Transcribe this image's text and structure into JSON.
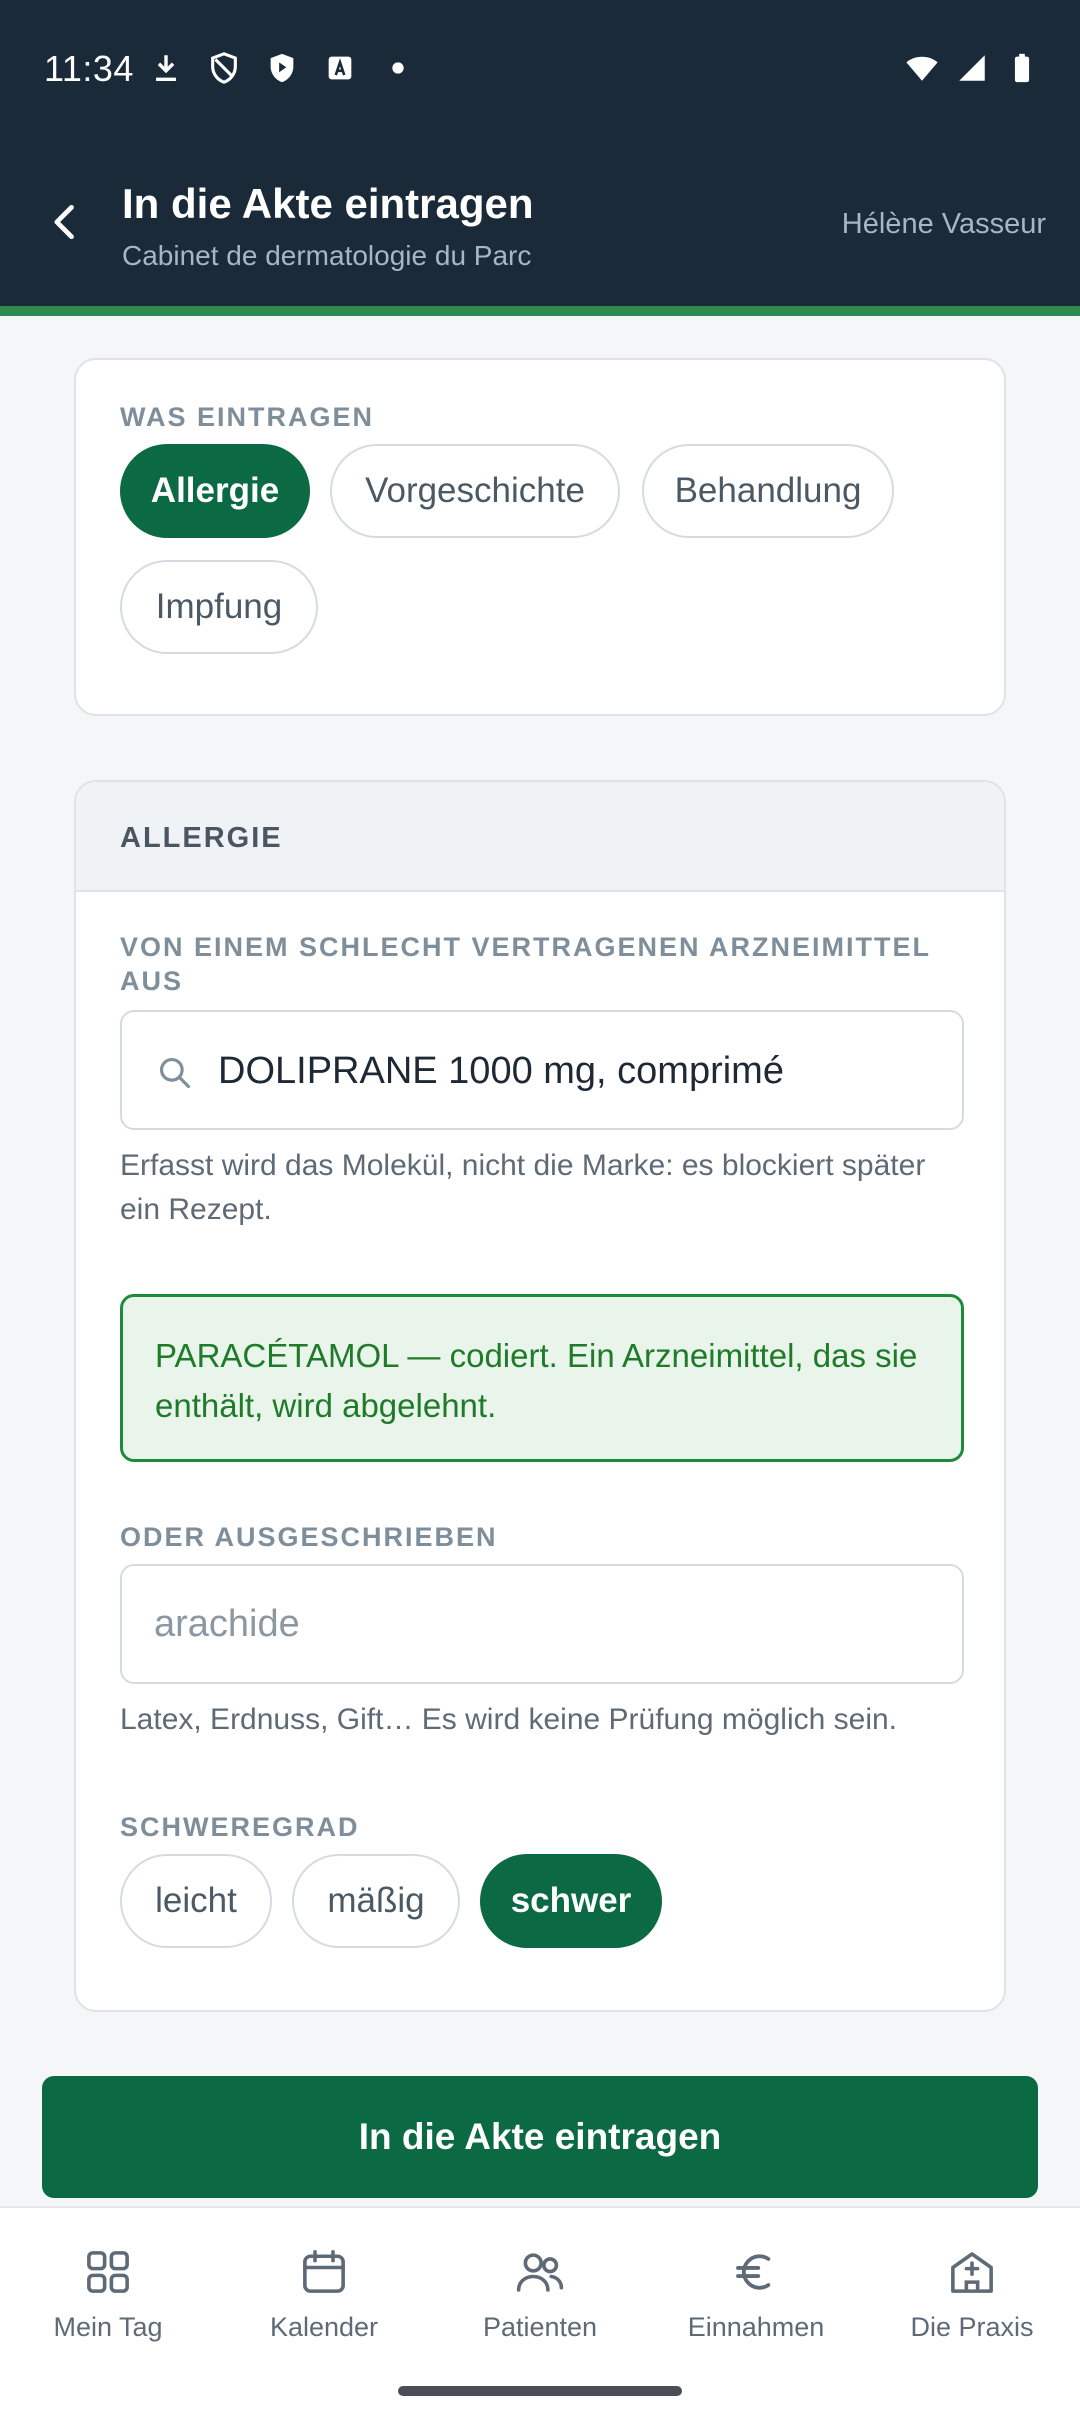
{
  "status_bar": {
    "time": "11:34",
    "left_icons": [
      "download-icon",
      "shield-icon",
      "play-protect-icon",
      "text-a-icon",
      "dot-icon"
    ],
    "right_icons": [
      "wifi-icon",
      "signal-icon",
      "battery-icon"
    ]
  },
  "app_bar": {
    "title": "In die Akte eintragen",
    "subtitle": "Cabinet de dermatologie du Parc",
    "user": "Hélène Vasseur",
    "back_icon": "arrow-back-icon"
  },
  "entry_type": {
    "label": "WAS EINTRAGEN",
    "options": [
      {
        "label": "Allergie",
        "selected": true
      },
      {
        "label": "Vorgeschichte",
        "selected": false
      },
      {
        "label": "Behandlung",
        "selected": false
      },
      {
        "label": "Impfung",
        "selected": false
      }
    ]
  },
  "allergy": {
    "title": "ALLERGIE",
    "drug_label": "VON EINEM SCHLECHT VERTRAGENEN ARZNEIMITTEL AUS",
    "drug_value": "DOLIPRANE 1000 mg, comprimé",
    "drug_help": "Erfasst wird das Molekül, nicht die Marke: es blockiert später ein Rezept.",
    "notice": "PARACÉTAMOL — codiert. Ein Arzneimittel, das sie enthält, wird abgelehnt.",
    "freetext_label": "ODER AUSGESCHRIEBEN",
    "freetext_placeholder": "arachide",
    "freetext_help": "Latex, Erdnuss, Gift… Es wird keine Prüfung möglich sein.",
    "severity_label": "SCHWEREGRAD",
    "severity_options": [
      {
        "label": "leicht",
        "selected": false
      },
      {
        "label": "mäßig",
        "selected": false
      },
      {
        "label": "schwer",
        "selected": true
      }
    ]
  },
  "submit_label": "In die Akte eintragen",
  "nav": [
    {
      "label": "Mein Tag",
      "icon": "grid-icon"
    },
    {
      "label": "Kalender",
      "icon": "calendar-icon"
    },
    {
      "label": "Patienten",
      "icon": "patients-icon"
    },
    {
      "label": "Einnahmen",
      "icon": "euro-icon"
    },
    {
      "label": "Die Praxis",
      "icon": "practice-icon"
    }
  ],
  "colors": {
    "header": "#1a2a38",
    "accent": "#2e8a4e",
    "primary": "#0b6a43",
    "notice_bg": "#e9f5ea",
    "notice_text": "#1f7a2a"
  }
}
